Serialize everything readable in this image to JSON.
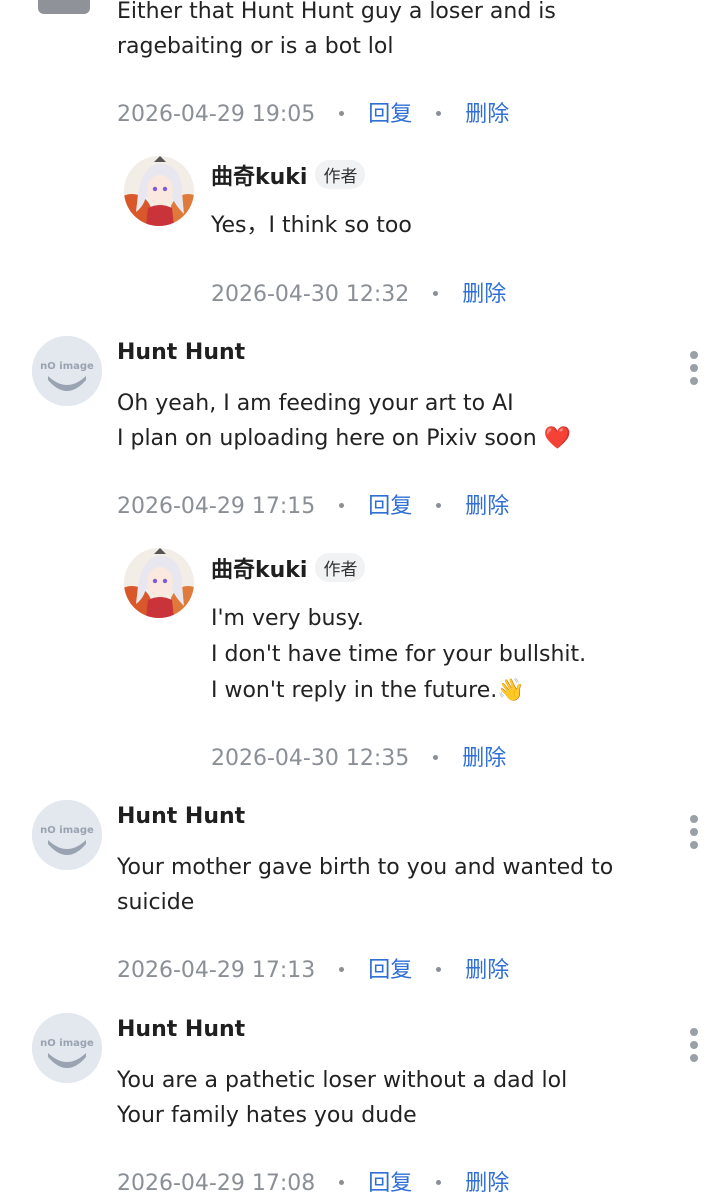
{
  "top_comment": {
    "lines": [
      "Either that Hunt Hunt guy a loser and is",
      "ragebaiting or is a bot lol"
    ],
    "timestamp": "2026-04-29 19:05",
    "reply_label": "回复",
    "delete_label": "删除",
    "reply": {
      "author": "曲奇kuki",
      "badge": "作者",
      "lines": [
        "Yes，I think so too"
      ],
      "timestamp": "2026-04-30 12:32",
      "delete_label": "删除"
    }
  },
  "comments": [
    {
      "author": "Hunt Hunt",
      "lines": [
        "Oh yeah, I am feeding your art to AI",
        "I plan on uploading here on Pixiv soon"
      ],
      "emoji": "❤️",
      "timestamp": "2026-04-29 17:15",
      "reply_label": "回复",
      "delete_label": "删除",
      "reply": {
        "author": "曲奇kuki",
        "badge": "作者",
        "lines": [
          "I'm very busy.",
          "I don't have time for your bullshit.",
          "I won't reply in the future."
        ],
        "emoji": "👋",
        "timestamp": "2026-04-30 12:35",
        "delete_label": "删除"
      }
    },
    {
      "author": "Hunt Hunt",
      "lines": [
        "Your mother gave birth to you and wanted to",
        "suicide"
      ],
      "timestamp": "2026-04-29 17:13",
      "reply_label": "回复",
      "delete_label": "删除"
    },
    {
      "author": "Hunt Hunt",
      "lines": [
        "You are a pathetic loser without a dad lol",
        "Your family hates you dude"
      ],
      "timestamp": "2026-04-29 17:08",
      "reply_label": "回复",
      "delete_label": "删除"
    }
  ],
  "no_image_text": "nO image",
  "icons": {
    "menu": "more-vertical-icon",
    "no_image_avatar": "no-image-avatar-icon"
  },
  "colors": {
    "action": "#2f6fd6",
    "meta": "#8a8f96",
    "heart": "#d9252c"
  }
}
